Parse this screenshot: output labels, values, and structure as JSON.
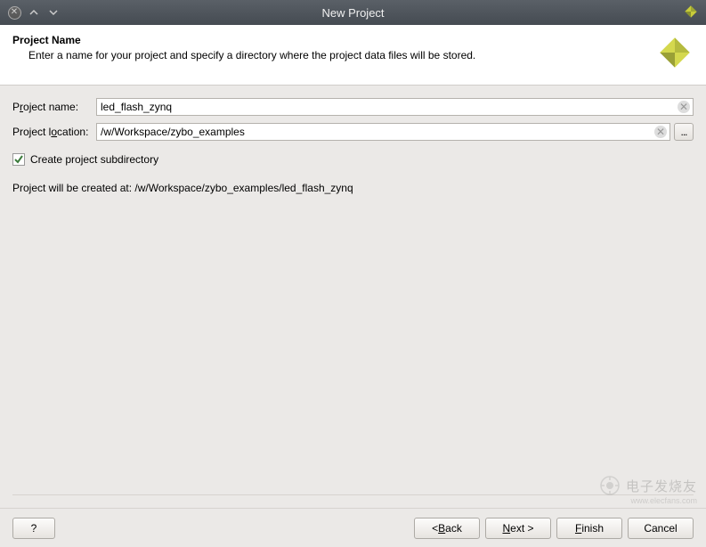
{
  "titlebar": {
    "title": "New Project"
  },
  "header": {
    "title": "Project Name",
    "description": "Enter a name for your project and specify a directory where the project data files will be stored."
  },
  "form": {
    "name_label_pre": "P",
    "name_label_u": "r",
    "name_label_post": "oject name:",
    "name_value": "led_flash_zynq",
    "location_label_pre": "Project l",
    "location_label_u": "o",
    "location_label_post": "cation:",
    "location_value": "/w/Workspace/zybo_examples",
    "browse_label": "...",
    "subdir_checked": true,
    "subdir_label": "Create project subdirectory",
    "create_path_label": "Project will be created at: /w/Workspace/zybo_examples/led_flash_zynq"
  },
  "footer": {
    "help_label": "?",
    "back_pre": "< ",
    "back_u": "B",
    "back_post": "ack",
    "next_u": "N",
    "next_post": "ext >",
    "finish_u": "F",
    "finish_post": "inish",
    "cancel_label": "Cancel"
  },
  "watermark": {
    "text": "电子发烧友",
    "sub": "www.elecfans.com"
  },
  "colors": {
    "accent": "#c8cc3a"
  }
}
